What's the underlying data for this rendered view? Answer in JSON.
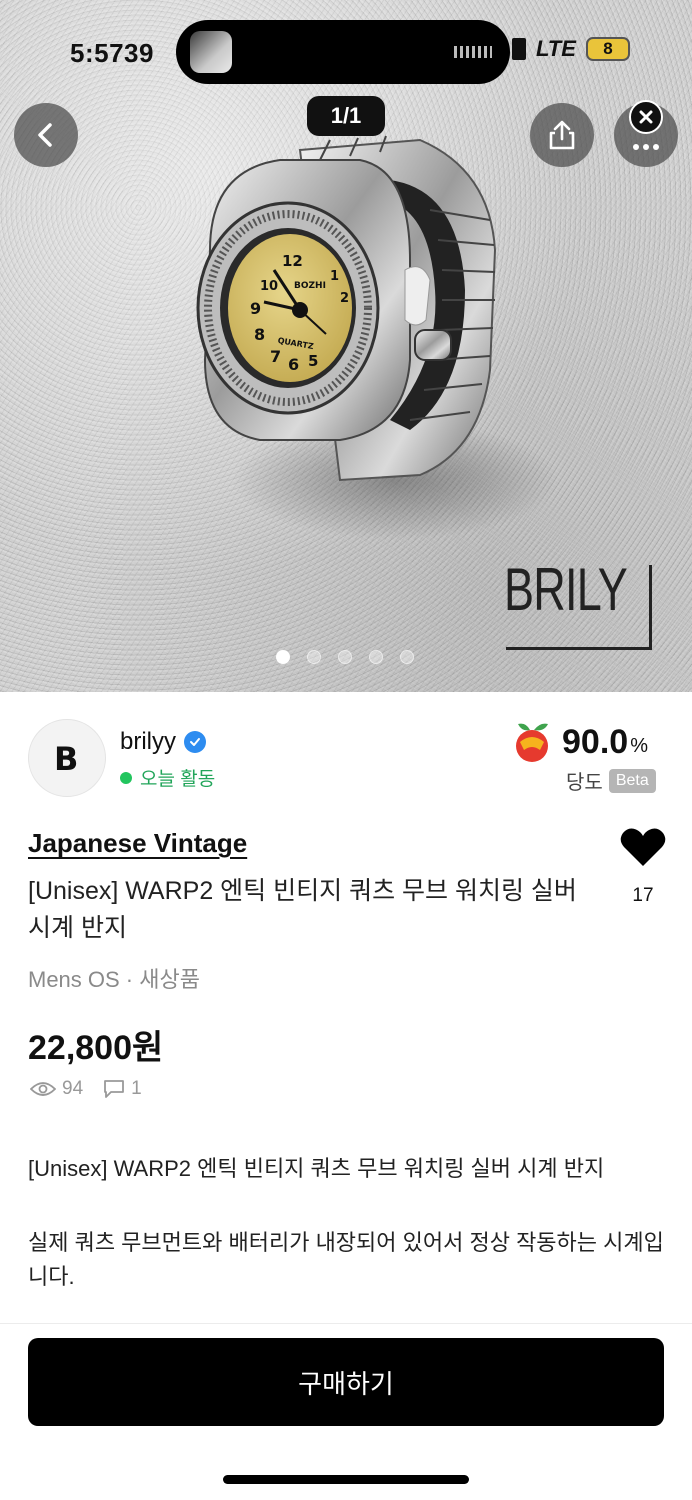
{
  "status_bar": {
    "time": "5:5739",
    "network": "LTE",
    "battery": "8"
  },
  "header": {
    "page_indicator": "1/1"
  },
  "image": {
    "watermark": "BRILY",
    "dot_count": 5,
    "active_dot": 0
  },
  "seller": {
    "avatar_letter": "B",
    "name": "brilyy",
    "activity": "오늘 활동",
    "rating_value": "90.0",
    "rating_unit": "%",
    "rating_label": "당도",
    "rating_badge": "Beta"
  },
  "product": {
    "category": "Japanese Vintage",
    "title": "[Unisex] WARP2 엔틱 빈티지 쿼츠 무브 워치링 실버 시계 반지",
    "likes": "17",
    "meta": "Mens OS · 새상품",
    "price": "22,800원",
    "views": "94",
    "chats": "1",
    "description_1": "[Unisex] WARP2 엔틱 빈티지 쿼츠 무브 워치링 실버 시계 반지",
    "description_2": "실제 쿼츠 무브먼트와 배터리가 내장되어 있어서 정상 작동하는 시계입니다."
  },
  "actions": {
    "buy_label": "구매하기"
  },
  "colors": {
    "activity_green": "#22c55e",
    "verified_blue": "#2d8cf0",
    "primary_button": "#000000"
  },
  "icons": [
    "back-icon",
    "share-icon",
    "more-icon",
    "close-icon",
    "verified-icon",
    "fruit-icon",
    "heart-icon",
    "eye-icon",
    "chat-icon"
  ]
}
